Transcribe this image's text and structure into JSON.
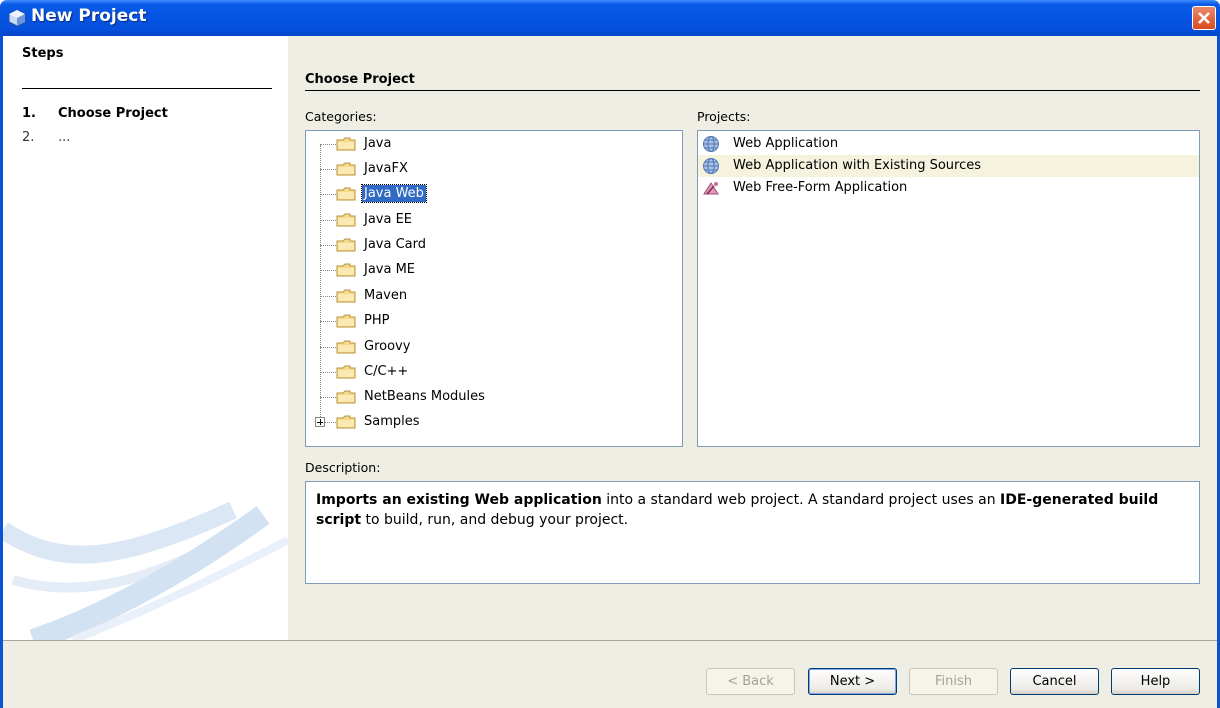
{
  "window": {
    "title": "New Project",
    "close_icon": "close-icon"
  },
  "steps": {
    "heading": "Steps",
    "items": [
      {
        "num": "1.",
        "label": "Choose Project"
      },
      {
        "num": "2.",
        "label": "..."
      }
    ]
  },
  "content": {
    "heading": "Choose Project",
    "categories_label": "Categories:",
    "projects_label": "Projects:",
    "description_label": "Description:",
    "categories": [
      "Java",
      "JavaFX",
      "Java Web",
      "Java EE",
      "Java Card",
      "Java ME",
      "Maven",
      "PHP",
      "Groovy",
      "C/C++",
      "NetBeans Modules",
      "Samples"
    ],
    "selected_category": "Java Web",
    "projects": [
      {
        "label": "Web Application",
        "icon": "globe-icon"
      },
      {
        "label": "Web Application with Existing Sources",
        "icon": "globe-icon"
      },
      {
        "label": "Web Free-Form Application",
        "icon": "freeform-icon"
      }
    ],
    "description": {
      "bold1": "Imports an existing Web application",
      "text1": " into a standard web project. A standard project uses an ",
      "bold2": "IDE-generated build script",
      "text2": " to build, run, and debug your project."
    }
  },
  "buttons": {
    "back": "< Back",
    "next": "Next >",
    "finish": "Finish",
    "cancel": "Cancel",
    "help": "Help"
  },
  "colors": {
    "titlebar": "#0554e3",
    "selection": "#316ac5",
    "panel_bg": "#efeee5"
  }
}
